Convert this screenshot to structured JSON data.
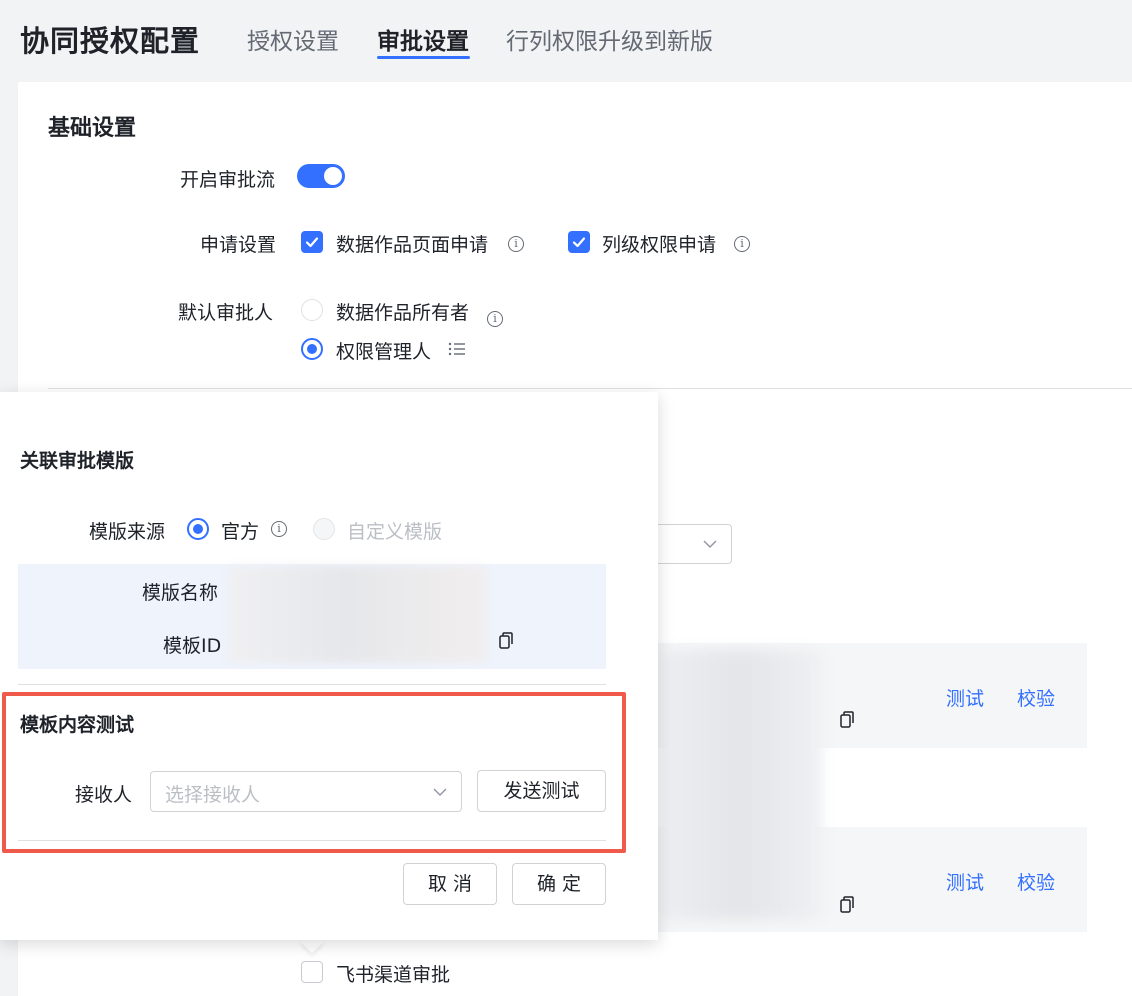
{
  "header": {
    "title": "协同授权配置",
    "tabs": [
      {
        "label": "授权设置"
      },
      {
        "label": "审批设置"
      },
      {
        "label": "行列权限升级到新版"
      }
    ]
  },
  "basic": {
    "section_title": "基础设置",
    "approval_flow_label": "开启审批流",
    "approval_flow_on": true,
    "apply_label": "申请设置",
    "apply_options": [
      {
        "label": "数据作品页面申请",
        "checked": true
      },
      {
        "label": "列级权限申请",
        "checked": true
      }
    ],
    "approver_label": "默认审批人",
    "approver_options": [
      {
        "label": "数据作品所有者",
        "selected": false
      },
      {
        "label": "权限管理人",
        "selected": true
      }
    ]
  },
  "background": {
    "links": [
      {
        "test": "测试",
        "verify": "校验"
      },
      {
        "test": "测试",
        "verify": "校验"
      }
    ],
    "feishu_label": "飞书渠道审批",
    "feishu_checked": false
  },
  "popup": {
    "title": "关联审批模版",
    "source_label": "模版来源",
    "source_options": [
      {
        "label": "官方",
        "selected": true
      },
      {
        "label": "自定义模版",
        "selected": false,
        "disabled": true
      }
    ],
    "template_name_label": "模版名称",
    "template_id_label": "模板ID",
    "test_section_title": "模板内容测试",
    "receiver_label": "接收人",
    "receiver_placeholder": "选择接收人",
    "send_test_label": "发送测试",
    "cancel_label": "取 消",
    "confirm_label": "确 定"
  },
  "colors": {
    "accent": "#3370ff",
    "highlight": "#f05a4a"
  },
  "icons": [
    "info-icon",
    "list-icon",
    "copy-icon",
    "chevron-down-icon",
    "check-icon"
  ]
}
